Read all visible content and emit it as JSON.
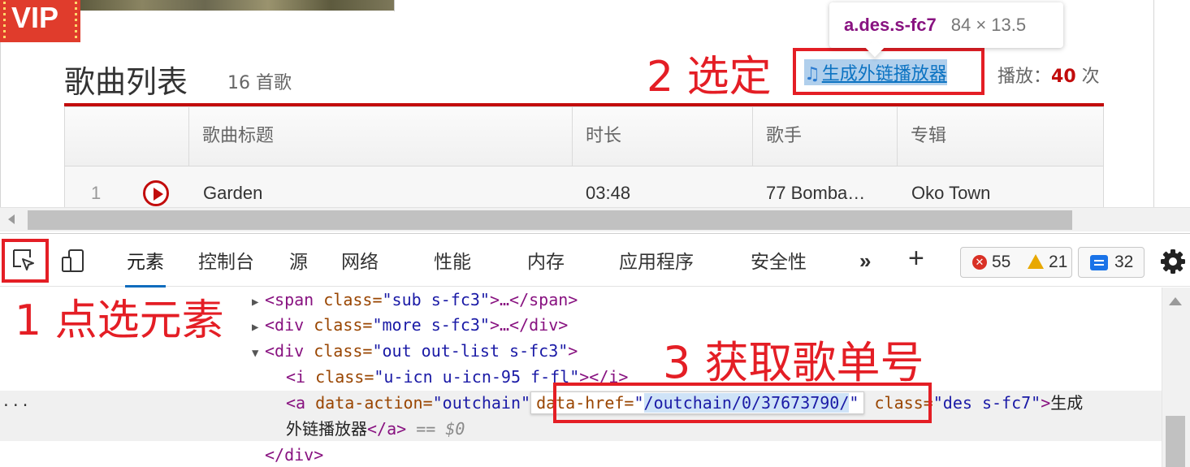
{
  "page": {
    "vip_label": "VIP",
    "list_title": "歌曲列表",
    "list_count": "16 首歌",
    "outchain_icon": "music-note-icon",
    "outchain_label": "生成外链播放器",
    "play_label": "播放：",
    "play_count": "40",
    "play_unit": " 次",
    "table": {
      "headers": [
        "",
        "歌曲标题",
        "时长",
        "歌手",
        "专辑"
      ],
      "rows": [
        {
          "index": "1",
          "title": "Garden",
          "duration": "03:48",
          "artist": "77 Bomba…",
          "album": "Oko Town"
        }
      ]
    }
  },
  "tooltip": {
    "selector": "a.des.s-fc7",
    "size": "84 × 13.5"
  },
  "devtools": {
    "tabs": [
      "元素",
      "控制台",
      "源",
      "网络",
      "性能",
      "内存",
      "应用程序",
      "安全性"
    ],
    "active_tab": "元素",
    "more_tabs": "»",
    "add_tab": "+",
    "errors": "55",
    "warnings": "21",
    "messages": "32",
    "code": {
      "l1_tag_open": "<span",
      "l1_attr": " class=",
      "l1_val": "\"sub s-fc3\"",
      "l1_rest": ">…</span>",
      "l2_tag_open": "<div",
      "l2_attr": " class=",
      "l2_val": "\"more s-fc3\"",
      "l2_rest": ">…</div>",
      "l3_tag_open": "<div",
      "l3_attr": " class=",
      "l3_val": "\"out out-list s-fc3\"",
      "l3_rest": ">",
      "l4_tag_open": "<i",
      "l4_attr": " class=",
      "l4_val": "\"u-icn u-icn-95 f-fl\"",
      "l4_rest": "></i>",
      "l5_tag_open": "<a",
      "l5_attr1": " data-action=",
      "l5_val1": "\"outchain\"",
      "l5_href_attr": "data-href=",
      "l5_href_q1": "\"",
      "l5_href_val": "/outchain/0/37673790/",
      "l5_href_q2": "\"",
      "l5_attr3": " class=",
      "l5_val3": "\"des s-fc7\"",
      "l5_rest": ">",
      "l5_text": "生成",
      "l6_text": "外链播放器",
      "l6_close": "</a>",
      "l6_ref": " == $0",
      "l7_close": "</div>",
      "ellipsis": "···"
    }
  },
  "annotations": {
    "step1": "1 点选元素",
    "step2": "2 选定",
    "step3": "3 获取歌单号"
  },
  "colors": {
    "annotation_red": "#e41e25",
    "brand_red": "#c20c0c",
    "link_blue": "#0c73c2",
    "devtools_tab_accent": "#0f6cbd"
  }
}
